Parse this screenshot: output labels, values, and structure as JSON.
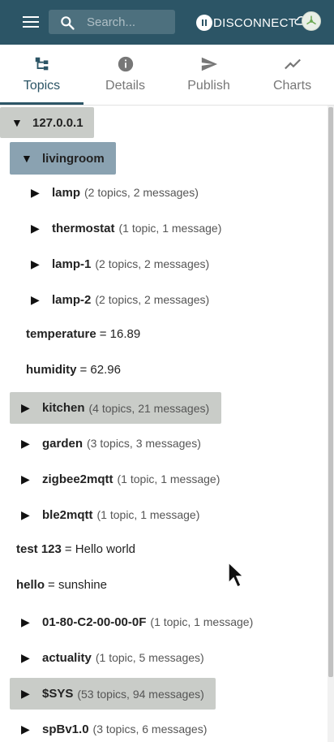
{
  "appbar": {
    "menu_icon": "hamburger-menu-icon",
    "search_placeholder": "Search...",
    "disconnect_label": "DISCONNECT",
    "colors": {
      "bar": "#2c5566",
      "text": "#ffffff"
    }
  },
  "tabs": [
    {
      "label": "Topics",
      "icon": "tree-icon",
      "active": true
    },
    {
      "label": "Details",
      "icon": "info-icon",
      "active": false
    },
    {
      "label": "Publish",
      "icon": "send-icon",
      "active": false
    },
    {
      "label": "Charts",
      "icon": "line-chart-icon",
      "active": false
    }
  ],
  "tree": {
    "root": {
      "arrow": "▼",
      "name": "127.0.0.1"
    },
    "livingroom": {
      "arrow": "▼",
      "name": "livingroom",
      "children": [
        {
          "arrow": "▶",
          "name": "lamp",
          "meta": "(2 topics, 2 messages)"
        },
        {
          "arrow": "▶",
          "name": "thermostat",
          "meta": "(1 topic, 1 message)"
        },
        {
          "arrow": "▶",
          "name": "lamp-1",
          "meta": "(2 topics, 2 messages)"
        },
        {
          "arrow": "▶",
          "name": "lamp-2",
          "meta": "(2 topics, 2 messages)"
        }
      ],
      "values": [
        {
          "name": "temperature",
          "value": "= 16.89"
        },
        {
          "name": "humidity",
          "value": "= 62.96"
        }
      ]
    },
    "siblings": [
      {
        "arrow": "▶",
        "name": "kitchen",
        "meta": "(4 topics, 21 messages)"
      },
      {
        "arrow": "▶",
        "name": "garden",
        "meta": "(3 topics, 3 messages)"
      },
      {
        "arrow": "▶",
        "name": "zigbee2mqtt",
        "meta": "(1 topic, 1 message)"
      },
      {
        "arrow": "▶",
        "name": "ble2mqtt",
        "meta": "(1 topic, 1 message)"
      }
    ],
    "root_values": [
      {
        "name": "test 123",
        "value": "= Hello world"
      },
      {
        "name": "hello",
        "value": "= sunshine"
      }
    ],
    "more": [
      {
        "arrow": "▶",
        "name": "01-80-C2-00-00-0F",
        "meta": "(1 topic, 1 message)"
      },
      {
        "arrow": "▶",
        "name": "actuality",
        "meta": "(1 topic, 5 messages)"
      },
      {
        "arrow": "▶",
        "name": "$SYS",
        "meta": "(53 topics, 94 messages)"
      },
      {
        "arrow": "▶",
        "name": "spBv1.0",
        "meta": "(3 topics, 6 messages)"
      }
    ]
  }
}
